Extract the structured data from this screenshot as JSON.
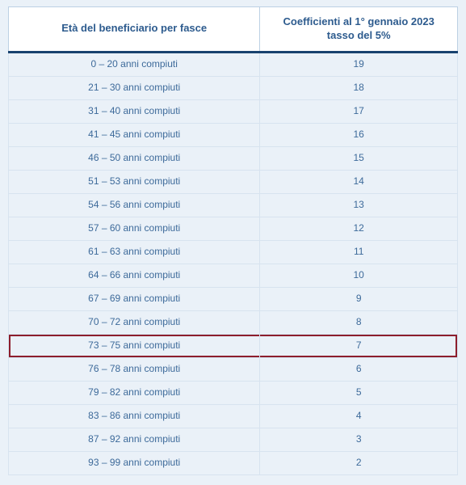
{
  "chart_data": {
    "type": "table",
    "title": "",
    "columns": [
      "Età del beneficiario per fasce",
      "Coefficienti al 1° gennaio 2023 tasso del 5%"
    ],
    "rows": [
      {
        "range": "0 – 20 anni compiuti",
        "coef": 19,
        "highlight": false
      },
      {
        "range": "21 – 30 anni compiuti",
        "coef": 18,
        "highlight": false
      },
      {
        "range": "31 – 40 anni compiuti",
        "coef": 17,
        "highlight": false
      },
      {
        "range": "41 – 45 anni compiuti",
        "coef": 16,
        "highlight": false
      },
      {
        "range": "46 – 50 anni compiuti",
        "coef": 15,
        "highlight": false
      },
      {
        "range": "51 – 53 anni compiuti",
        "coef": 14,
        "highlight": false
      },
      {
        "range": "54 – 56 anni compiuti",
        "coef": 13,
        "highlight": false
      },
      {
        "range": "57 – 60 anni compiuti",
        "coef": 12,
        "highlight": false
      },
      {
        "range": "61 – 63 anni compiuti",
        "coef": 11,
        "highlight": false
      },
      {
        "range": "64 – 66 anni compiuti",
        "coef": 10,
        "highlight": false
      },
      {
        "range": "67 – 69 anni compiuti",
        "coef": 9,
        "highlight": false
      },
      {
        "range": "70 – 72 anni compiuti",
        "coef": 8,
        "highlight": false
      },
      {
        "range": "73 – 75 anni compiuti",
        "coef": 7,
        "highlight": true
      },
      {
        "range": "76 – 78 anni compiuti",
        "coef": 6,
        "highlight": false
      },
      {
        "range": "79 – 82 anni compiuti",
        "coef": 5,
        "highlight": false
      },
      {
        "range": "83 – 86 anni compiuti",
        "coef": 4,
        "highlight": false
      },
      {
        "range": "87 – 92 anni compiuti",
        "coef": 3,
        "highlight": false
      },
      {
        "range": "93 – 99 anni compiuti",
        "coef": 2,
        "highlight": false
      }
    ]
  },
  "header": {
    "col1": "Età del beneficiario per fasce",
    "col2_line1": "Coefficienti al 1° gennaio 2023",
    "col2_line2": "tasso del 5%"
  }
}
